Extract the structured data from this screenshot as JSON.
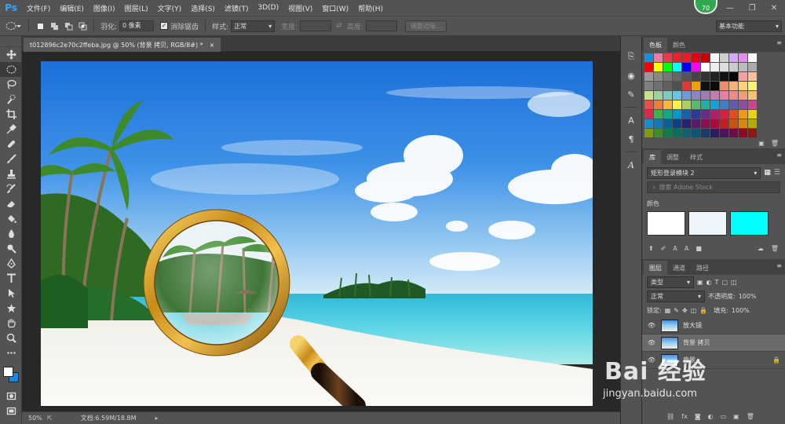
{
  "app": {
    "logo": "Ps",
    "menus": [
      "文件(F)",
      "编辑(E)",
      "图像(I)",
      "图层(L)",
      "文字(Y)",
      "选择(S)",
      "滤镜(T)",
      "3D(D)",
      "视图(V)",
      "窗口(W)",
      "帮助(H)"
    ],
    "badge": "70",
    "window_controls": [
      "—",
      "❐",
      "✕"
    ]
  },
  "options": {
    "feather_label": "羽化:",
    "feather_value": "0 像素",
    "antialias_label": "消除锯齿",
    "style_label": "样式:",
    "style_value": "正常",
    "width_label": "宽度:",
    "height_label": "高度:",
    "refine_button": "调整边缘...",
    "workspace": "基本功能"
  },
  "document": {
    "tab_title": "t012896c2e70c2ffeba.jpg @ 50% (背景 拷贝, RGB/8#) *",
    "tab_close": "×",
    "zoom": "50%",
    "doc_info": "文档:6.59M/18.8M"
  },
  "swatches": {
    "tabs": [
      "色板",
      "颜色"
    ],
    "colors": [
      "#1e8cd6",
      "#ee7aa8",
      "#e83c4a",
      "#e8232a",
      "#e71e24",
      "#e60012",
      "#cc0000",
      "#ffffff",
      "#cfcfcf",
      "#d4a8ff",
      "#e88bf0",
      "#ffffff",
      "#ff0000",
      "#ffff00",
      "#00ff00",
      "#00ffff",
      "#0000ff",
      "#ff00ff",
      "#ffffff",
      "#eeeeee",
      "#dddddd",
      "#cccccc",
      "#bbbbbb",
      "#aaaaaa",
      "#999999",
      "#888888",
      "#777777",
      "#666666",
      "#555555",
      "#444444",
      "#333333",
      "#222222",
      "#111111",
      "#000000",
      "#f5a09c",
      "#f8c09a",
      "#808080",
      "#707070",
      "#606060",
      "#505050",
      "#e33a2f",
      "#f5a000",
      "#101010",
      "#0a0a0a",
      "#ef8c6c",
      "#f4b278",
      "#fbd17c",
      "#fdf07a",
      "#c7e08a",
      "#9fd39e",
      "#7ccbc2",
      "#68c3e6",
      "#6f9bd6",
      "#8b86c6",
      "#a17ab8",
      "#c37bb2",
      "#e67fa4",
      "#ee8a8a",
      "#f09c7c",
      "#f6c276",
      "#e6524a",
      "#ef7c3e",
      "#f8b43c",
      "#fff23e",
      "#a9d15a",
      "#5cba6a",
      "#22b1a0",
      "#14a3d8",
      "#3f7fc6",
      "#5a5eae",
      "#8b4f9e",
      "#c6488c",
      "#e0284a",
      "#3cb44a",
      "#10aa88",
      "#0096d0",
      "#1b5fb0",
      "#2b3a96",
      "#6a2a8a",
      "#b01e6e",
      "#d81e44",
      "#e84a1e",
      "#f39a10",
      "#e6d40e",
      "#1a8fd0",
      "#1278b8",
      "#0e5e9c",
      "#123f80",
      "#2a2070",
      "#571a6c",
      "#8c0e54",
      "#b0083c",
      "#c41e1e",
      "#c8560a",
      "#d68a06",
      "#b8a806",
      "#7f9c0c",
      "#3c8e26",
      "#0c7e46",
      "#08705a",
      "#0a6470",
      "#08577a",
      "#1a3a6a",
      "#2a1e5e",
      "#48165a",
      "#6a0e48",
      "#8a0a2e",
      "#8c1a12"
    ]
  },
  "library": {
    "tabs": [
      "库",
      "调整",
      "样式"
    ],
    "selected": "矩形登录模块 2",
    "search_placeholder": "搜索 Adobe Stock",
    "colors_heading": "颜色",
    "colors": [
      "#ffffff",
      "#eef6fb",
      "#00ffff"
    ]
  },
  "layers": {
    "tabs": [
      "图层",
      "通道",
      "路径"
    ],
    "filter_type": "类型",
    "blend_mode": "正常",
    "opacity_label": "不透明度:",
    "opacity_value": "100%",
    "lock_label": "锁定:",
    "fill_label": "填充:",
    "fill_value": "100%",
    "items": [
      {
        "name": "放大镜",
        "visible": true,
        "selected": false
      },
      {
        "name": "背景 拷贝",
        "visible": true,
        "selected": true
      },
      {
        "name": "背景",
        "visible": true,
        "selected": false
      }
    ]
  },
  "watermark": "Bai 经验",
  "watermark_url": "jingyan.baidu.com"
}
